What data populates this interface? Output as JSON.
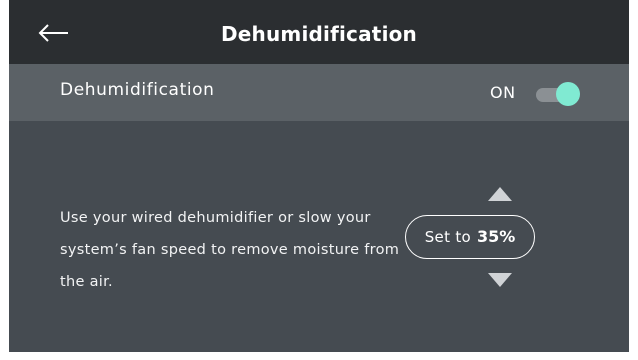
{
  "header": {
    "title": "Dehumidification",
    "back_icon": "back-arrow-icon"
  },
  "setting": {
    "label": "Dehumidification",
    "state_label": "ON",
    "enabled": true,
    "accent_color": "#80ead2"
  },
  "description": "Use your wired dehumidifier or slow your system’s fan speed to remove moisture from the air.",
  "setpoint": {
    "prefix": "Set to",
    "value": "35%",
    "increase_icon": "triangle-up-icon",
    "decrease_icon": "triangle-down-icon"
  }
}
